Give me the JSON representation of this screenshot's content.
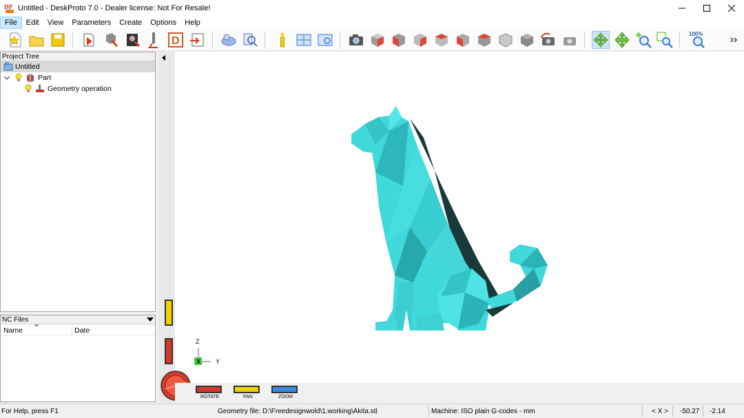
{
  "window": {
    "title": "Untitled - DeskProto 7.0 - Dealer license: Not For Resale!"
  },
  "menu": [
    "File",
    "Edit",
    "View",
    "Parameters",
    "Create",
    "Options",
    "Help"
  ],
  "toolbar": {
    "zoom_label": "100%"
  },
  "project_tree": {
    "header": "Project Tree",
    "root": "Untitled",
    "part": "Part",
    "operation": "Geometry operation"
  },
  "nc_files": {
    "header": "NC Files",
    "col_name": "Name",
    "col_date": "Date"
  },
  "viewport": {
    "axis_z": "Z",
    "axis_y": "Y",
    "axis_x": "X",
    "dial_rotate": "ROTATE",
    "dial_pan": "PAN",
    "dial_zoom": "ZOOM",
    "model_color": "#3fd9dc"
  },
  "status": {
    "help": "For Help, press F1",
    "geometry_file": "Geometry file: D:\\Freedesignwold\\1.working\\Akita.stl",
    "machine": "Machine: ISO plain G-codes - mm",
    "coord_label": "< X >",
    "coord_x": "-50.27",
    "coord_y": "-2.14"
  }
}
